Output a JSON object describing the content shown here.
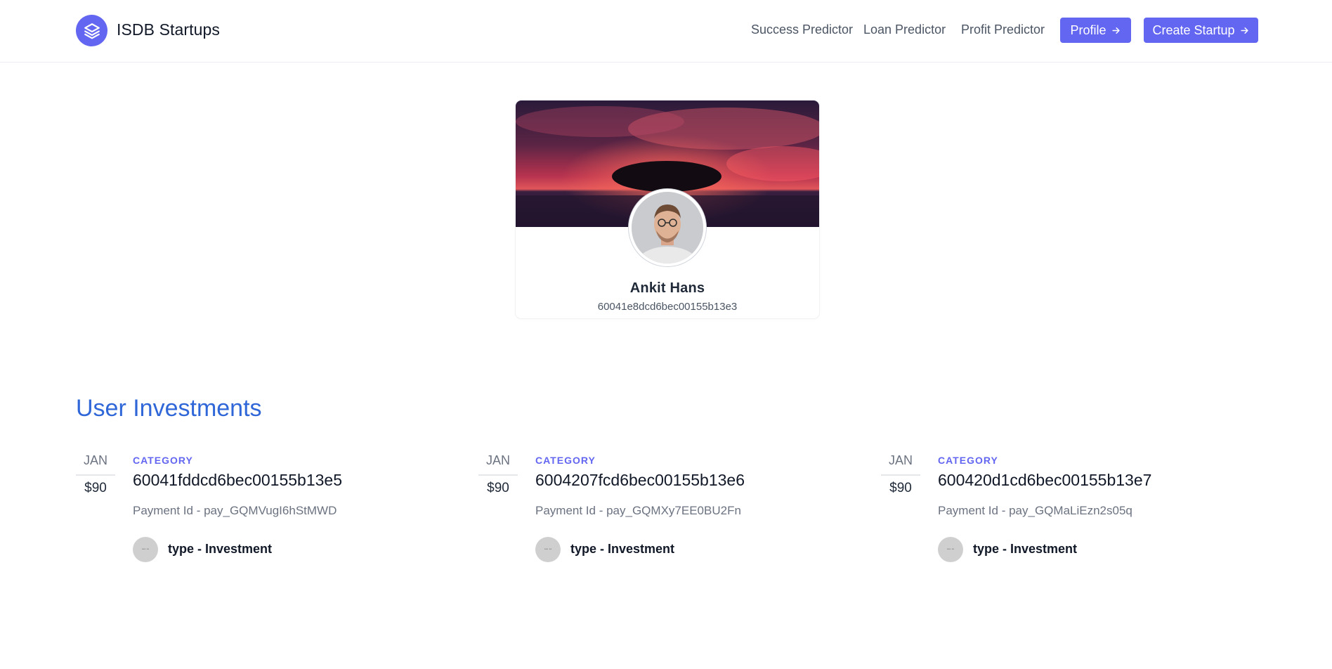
{
  "header": {
    "brand": "ISDB Startups",
    "nav": [
      "Success Predictor",
      "Loan Predictor",
      "Profit Predictor"
    ],
    "profile_button": "Profile",
    "create_button": "Create Startup",
    "accent_color": "#6366f1"
  },
  "profile": {
    "name": "Ankit Hans",
    "id": "60041e8dcd6bec00155b13e3"
  },
  "investments_section": {
    "title": "User Investments",
    "title_color": "#2f67d8"
  },
  "investments": [
    {
      "month": "JAN",
      "amount": "$90",
      "category_label": "CATEGORY",
      "title": "60041fddcd6bec00155b13e5",
      "payment": "Payment Id - pay_GQMVugI6hStMWD",
      "type": "type - Investment"
    },
    {
      "month": "JAN",
      "amount": "$90",
      "category_label": "CATEGORY",
      "title": "6004207fcd6bec00155b13e6",
      "payment": "Payment Id - pay_GQMXy7EE0BU2Fn",
      "type": "type - Investment"
    },
    {
      "month": "JAN",
      "amount": "$90",
      "category_label": "CATEGORY",
      "title": "600420d1cd6bec00155b13e7",
      "payment": "Payment Id - pay_GQMaLiEzn2s05q",
      "type": "type - Investment"
    }
  ]
}
